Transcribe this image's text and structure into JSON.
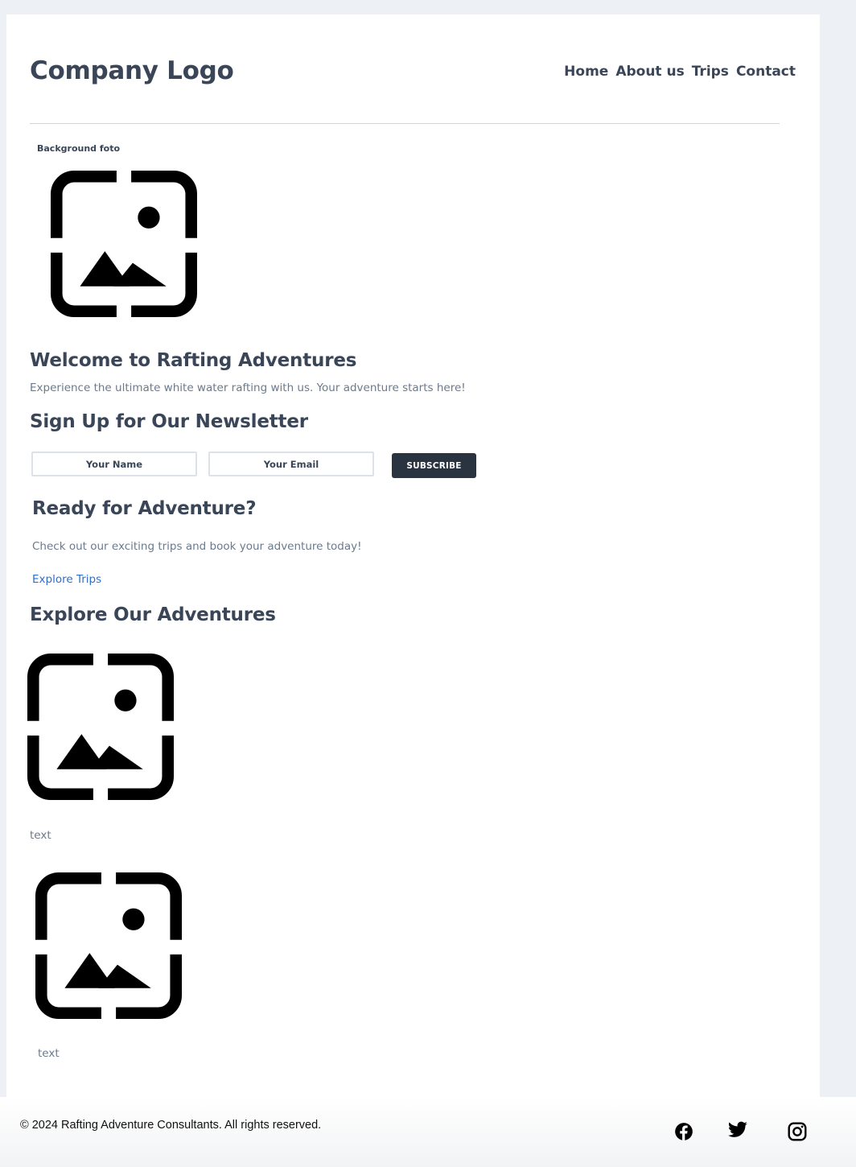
{
  "header": {
    "logo_text": "Company Logo",
    "nav": [
      {
        "label": "Home"
      },
      {
        "label": "About us"
      },
      {
        "label": "Trips"
      },
      {
        "label": "Contact"
      }
    ]
  },
  "hero": {
    "image_label": "Background foto",
    "image_icon": "image-placeholder-icon",
    "title": "Welcome to Rafting Adventures",
    "subtitle": "Experience the ultimate white water rafting with us. Your adventure starts here!"
  },
  "newsletter": {
    "title": "Sign Up for Our Newsletter",
    "name_placeholder": "Your Name",
    "email_placeholder": "Your Email",
    "button_label": "SUBSCRIBE"
  },
  "cta": {
    "title": "Ready for Adventure?",
    "text": "Check out our exciting trips and book your adventure today!",
    "link_label": "Explore Trips"
  },
  "adventures": {
    "title": "Explore Our Adventures",
    "items": [
      {
        "caption": "text",
        "icon": "image-placeholder-icon"
      },
      {
        "caption": "text",
        "icon": "image-placeholder-icon"
      }
    ]
  },
  "footer": {
    "copyright": "© 2024 Rafting Adventure Consultants. All rights reserved.",
    "social": [
      "facebook-icon",
      "twitter-icon",
      "instagram-icon"
    ]
  },
  "colors": {
    "page_bg": "#edf0f4",
    "heading": "#3a4658",
    "muted_text": "#6b7a8d",
    "link": "#2d6fce",
    "button_bg": "#2a3340"
  }
}
